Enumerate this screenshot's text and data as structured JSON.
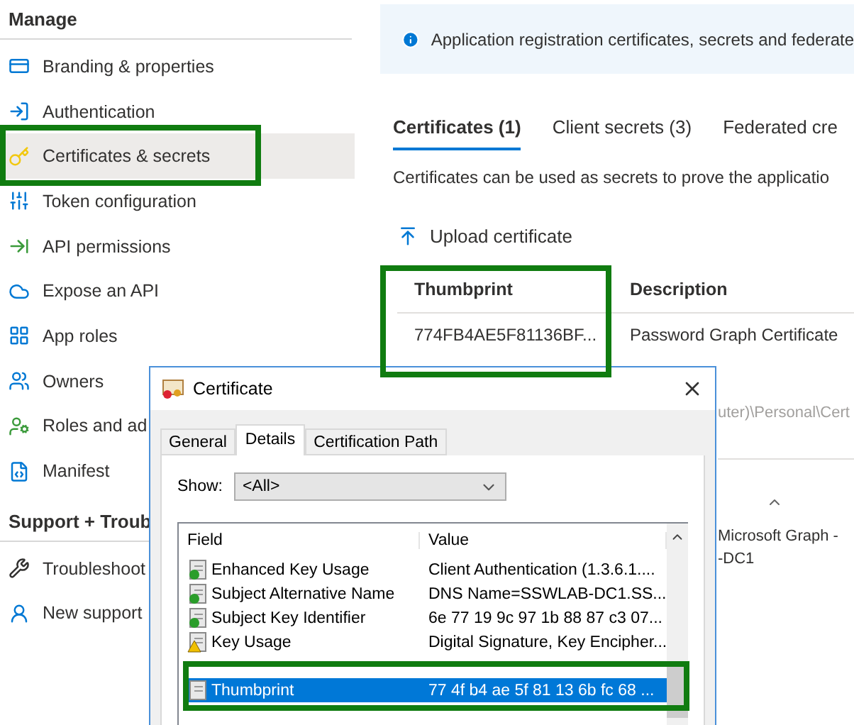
{
  "sidebar": {
    "sections": [
      {
        "title": "Manage",
        "items": [
          {
            "label": "Branding & properties",
            "selected": false
          },
          {
            "label": "Authentication",
            "selected": false
          },
          {
            "label": "Certificates & secrets",
            "selected": true
          },
          {
            "label": "Token configuration",
            "selected": false
          },
          {
            "label": "API permissions",
            "selected": false
          },
          {
            "label": "Expose an API",
            "selected": false
          },
          {
            "label": "App roles",
            "selected": false
          },
          {
            "label": "Owners",
            "selected": false
          },
          {
            "label": "Roles and ad",
            "selected": false
          },
          {
            "label": "Manifest",
            "selected": false
          }
        ]
      },
      {
        "title": "Support + Troub",
        "items": [
          {
            "label": "Troubleshoot",
            "selected": false
          },
          {
            "label": "New support",
            "selected": false
          }
        ]
      }
    ]
  },
  "banner": {
    "text": "Application registration certificates, secrets and federate"
  },
  "tabs": [
    {
      "label": "Certificates (1)",
      "selected": true
    },
    {
      "label": "Client secrets (3)",
      "selected": false
    },
    {
      "label": "Federated cre",
      "selected": false
    }
  ],
  "description": "Certificates can be used as secrets to prove the applicatio",
  "upload_button": "Upload certificate",
  "table": {
    "columns": [
      "Thumbprint",
      "Description"
    ],
    "rows": [
      [
        "774FB4AE5F81136BF...",
        "Password Graph Certificate"
      ]
    ]
  },
  "obscured": {
    "path": "uter)\\Personal\\Cert",
    "cell_1": "Microsoft Graph -",
    "cell_2": "-DC1"
  },
  "dialog": {
    "title": "Certificate",
    "tabs": [
      {
        "label": "General",
        "selected": false
      },
      {
        "label": "Details",
        "selected": true
      },
      {
        "label": "Certification Path",
        "selected": false
      }
    ],
    "show_label": "Show:",
    "show_value": "<All>",
    "columns": [
      "Field",
      "Value"
    ],
    "rows": [
      {
        "field": "Enhanced Key Usage",
        "value": "Client Authentication (1.3.6.1....",
        "kind": "extension",
        "selected": false
      },
      {
        "field": "Subject Alternative Name",
        "value": "DNS Name=SSWLAB-DC1.SS...",
        "kind": "extension",
        "selected": false
      },
      {
        "field": "Subject Key Identifier",
        "value": "6e 77 19 9c 97 1b 88 87 c3 07...",
        "kind": "extension",
        "selected": false
      },
      {
        "field": "Key Usage",
        "value": "Digital Signature, Key Encipher...",
        "kind": "warning",
        "selected": false
      },
      {
        "field": "Thumbprint",
        "value": "77 4f b4 ae 5f 81 13 6b fc 68 ...",
        "kind": "property",
        "selected": true
      }
    ]
  }
}
